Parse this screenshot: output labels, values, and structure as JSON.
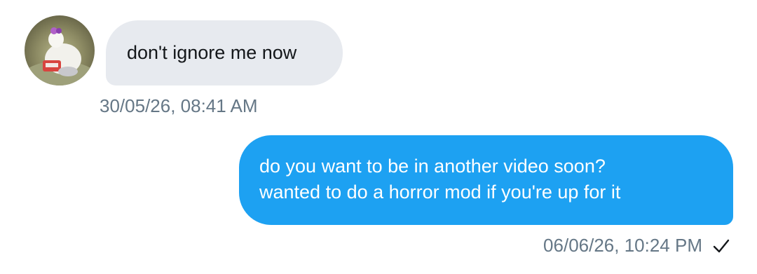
{
  "conversation": {
    "incoming": {
      "avatar_icon": "user-avatar-photo",
      "text": "don't ignore me now",
      "timestamp": "30/05/26, 08:41 AM"
    },
    "outgoing": {
      "lines": [
        "do you want to be in another video soon?",
        "wanted to do a horror mod if you're up for it"
      ],
      "timestamp": "06/06/26, 10:24 PM",
      "status_icon": "checkmark-icon"
    }
  },
  "colors": {
    "incoming_bubble": "#e7eaef",
    "outgoing_bubble": "#1da1f2",
    "timestamp_text": "#657786"
  }
}
